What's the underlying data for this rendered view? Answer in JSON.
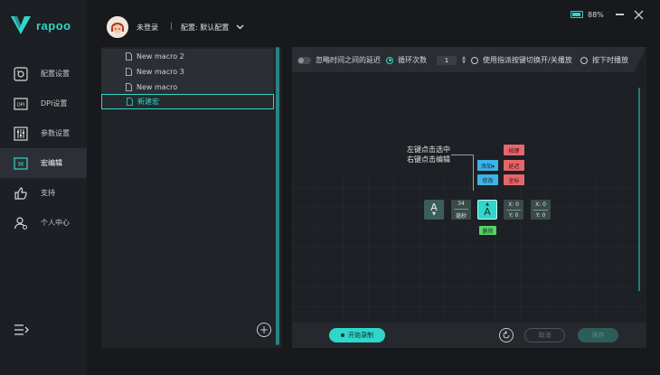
{
  "brand": {
    "name": "rapoo",
    "accent": "#2fd6c9"
  },
  "header": {
    "user": "未登录",
    "separator": "|",
    "config": "配置: 默认配置",
    "battery": "88%",
    "battery_level": 0.88
  },
  "sidebar": {
    "items": [
      {
        "label": "配置设置",
        "icon": "config-icon"
      },
      {
        "label": "DPI设置",
        "icon": "dpi-icon"
      },
      {
        "label": "参数设置",
        "icon": "sliders-icon"
      },
      {
        "label": "宏编辑",
        "icon": "macro-icon",
        "active": true
      },
      {
        "label": "支持",
        "icon": "thumbs-up-icon"
      },
      {
        "label": "个人中心",
        "icon": "user-icon"
      }
    ]
  },
  "macros": {
    "items": [
      {
        "label": "New macro 2"
      },
      {
        "label": "New macro 3"
      },
      {
        "label": "New macro"
      },
      {
        "label": "新建宏",
        "active": true
      }
    ],
    "add_label": "+"
  },
  "options": {
    "ignore_delay": "忽略时间之间的延迟",
    "loop": "循环次数",
    "loop_count": "1",
    "toggle_play": "使用指派按键切换开/关播放",
    "hold_play": "按下时播放"
  },
  "editor": {
    "hint_line1": "左键点击选中",
    "hint_line2": "右键点击编辑",
    "add": "添加▾",
    "modify": "修改",
    "delete": "删除",
    "menu_key": "按键",
    "menu_delay": "延迟",
    "menu_coord": "坐标",
    "key1_letter": "A",
    "key1_arrow": "▼",
    "delay_value": "34",
    "delay_unit": "毫秒",
    "key2_letter": "A",
    "key2_arrow": "▲",
    "coord1_x": "X: 0",
    "coord1_y": "Y: 0",
    "coord2_x": "X: 0",
    "coord2_y": "Y: 0"
  },
  "footer": {
    "record": "开始录制",
    "cancel": "取消",
    "save": "保存"
  }
}
